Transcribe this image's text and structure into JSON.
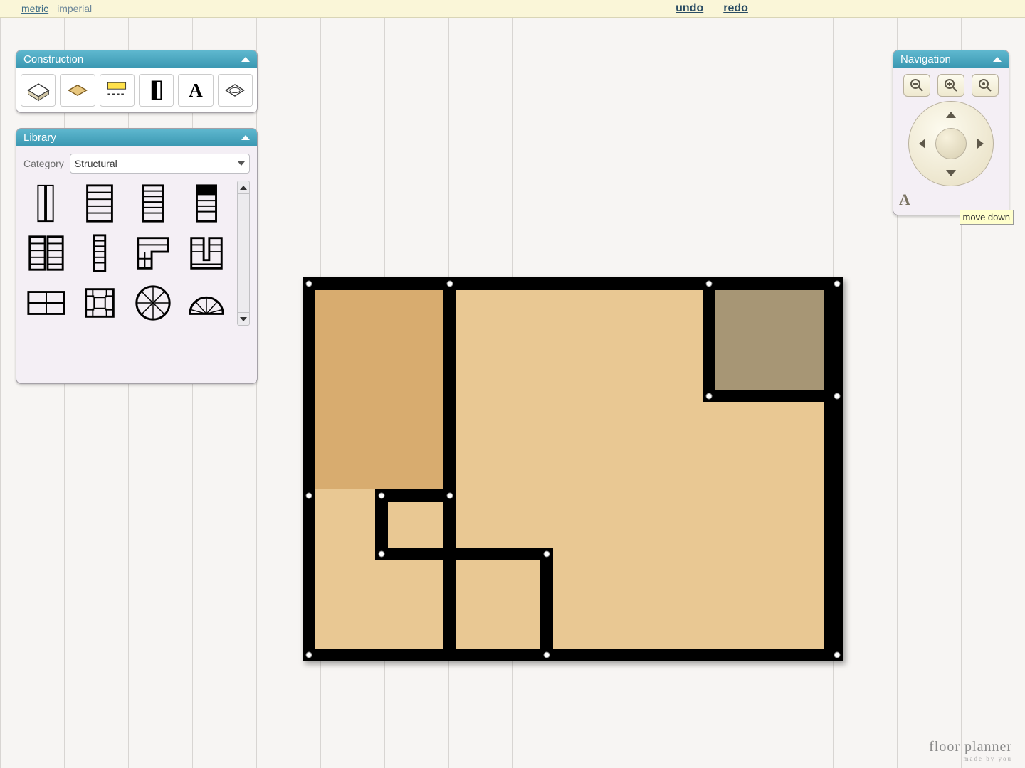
{
  "topbar": {
    "unit_metric": "metric",
    "unit_imperial": "imperial",
    "undo": "undo",
    "redo": "redo"
  },
  "panels": {
    "construction": {
      "title": "Construction"
    },
    "library": {
      "title": "Library",
      "category_label": "Category",
      "category_selected": "Structural"
    },
    "navigation": {
      "title": "Navigation"
    }
  },
  "tooltip": {
    "move_down": "move down"
  },
  "brand": {
    "name": "floor planner",
    "tagline": "made by you"
  },
  "construction_tools": [
    {
      "id": "room-tool"
    },
    {
      "id": "surface-tool"
    },
    {
      "id": "dimension-tool"
    },
    {
      "id": "door-tool"
    },
    {
      "id": "text-tool"
    },
    {
      "id": "ceiling-tool"
    }
  ],
  "library_items": [
    {
      "id": "door-single"
    },
    {
      "id": "stair-straight-narrow"
    },
    {
      "id": "stair-straight"
    },
    {
      "id": "stair-landing-top"
    },
    {
      "id": "stair-double"
    },
    {
      "id": "stair-i"
    },
    {
      "id": "stair-l"
    },
    {
      "id": "stair-u"
    },
    {
      "id": "stair-wide"
    },
    {
      "id": "stair-square"
    },
    {
      "id": "stair-spiral"
    },
    {
      "id": "stair-curved"
    }
  ],
  "nav": {
    "text_tool": "A"
  },
  "floorplan": {
    "wall_thickness": 18,
    "rooms": [
      {
        "name": "room-left",
        "fill": "#d8ac6f"
      },
      {
        "name": "room-main",
        "fill": "#e9c893"
      },
      {
        "name": "room-alcove",
        "fill": "#a79675"
      }
    ]
  }
}
